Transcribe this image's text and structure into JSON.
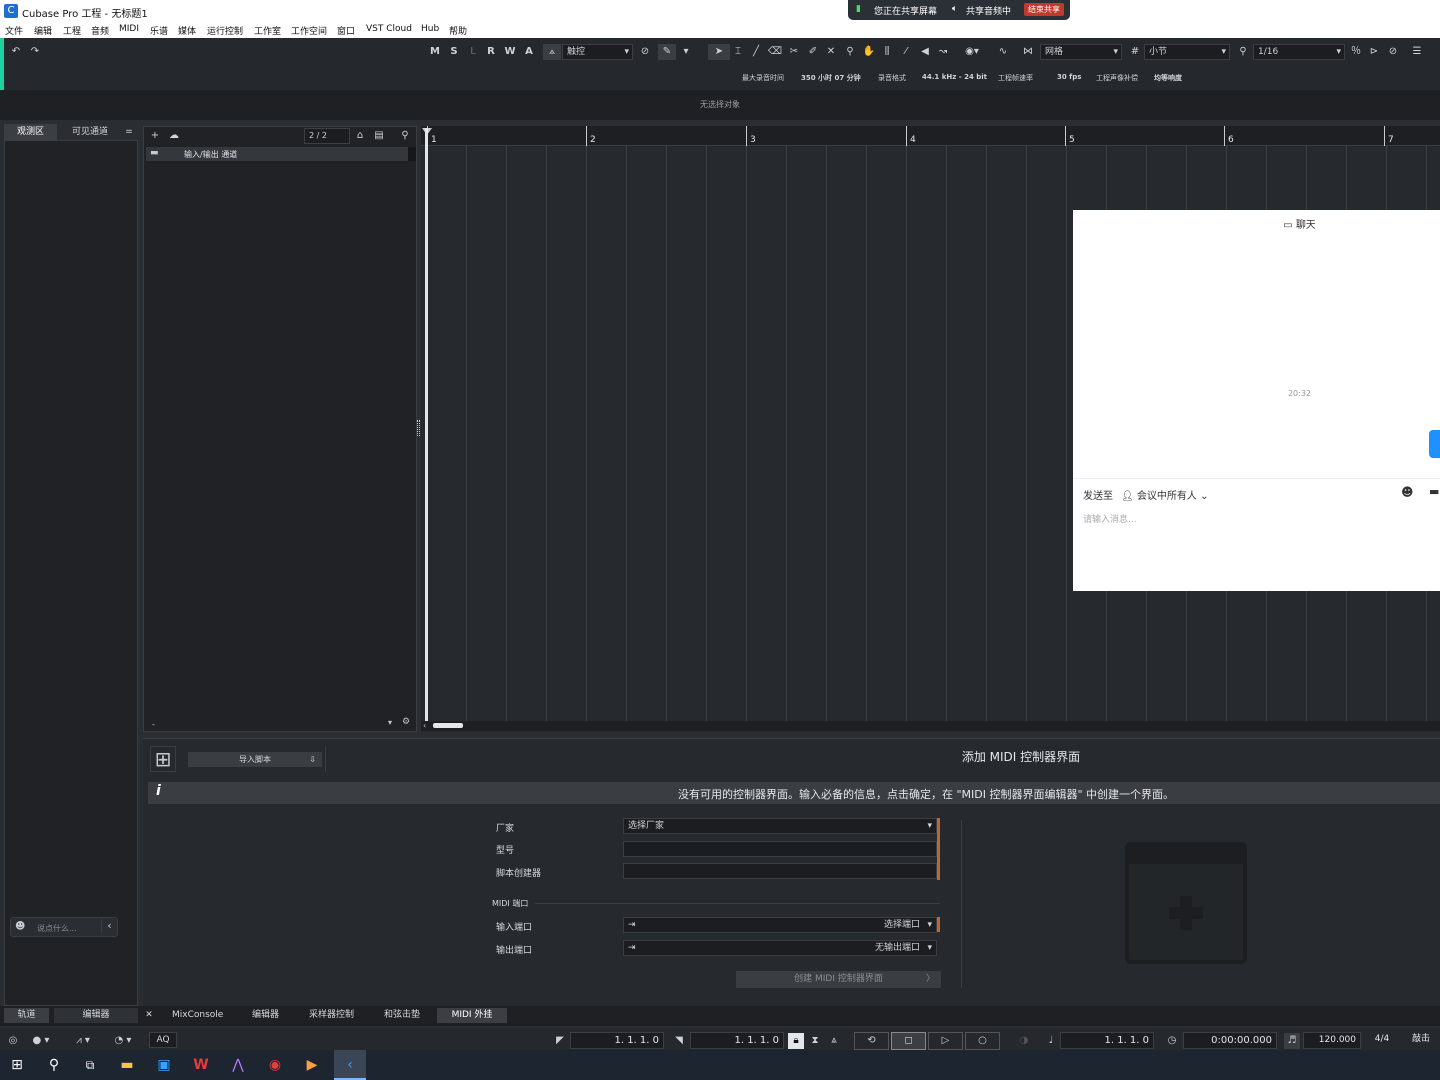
{
  "window": {
    "title": "Cubase Pro 工程 - 无标题1",
    "logo": "C"
  },
  "share": {
    "sharing": "您正在共享屏幕",
    "audio": "共享音频中",
    "end": "结束共享"
  },
  "menu": [
    "文件",
    "编辑",
    "工程",
    "音频",
    "MIDI",
    "乐谱",
    "媒体",
    "运行控制",
    "工作室",
    "工作空间",
    "窗口",
    "VST Cloud",
    "Hub",
    "帮助"
  ],
  "toolbar": {
    "track_buttons": [
      "M",
      "S",
      "L",
      "R",
      "W",
      "A"
    ],
    "automation_mode": "触控",
    "snap_type": "网格",
    "grid": "小节",
    "quantize": "1/16",
    "info": {
      "max_rec_label": "最大录音时间",
      "max_rec_value": "350 小时 07 分钟",
      "rec_format_label": "录音格式",
      "rec_format_value": "44.1 kHz - 24 bit",
      "framerate_label": "工程帧速率",
      "framerate_value": "30 fps",
      "pan_label": "工程声像补偿",
      "pan_value": "均等响度"
    },
    "no_selection": "无选择对象"
  },
  "left_panel": {
    "tab_inspector": "观测区",
    "tab_visible": "可见通道",
    "menu_icon": "=",
    "chat_placeholder": "说点什么..."
  },
  "track_list": {
    "counter": "2 / 2",
    "track_name": "输入/输出 通道",
    "footer": "-"
  },
  "ruler": [
    "1",
    "2",
    "3",
    "4",
    "5",
    "6",
    "7"
  ],
  "chat": {
    "title": "聊天",
    "time": "20:32",
    "send_to_label": "发送至",
    "send_to_value": "会议中所有人",
    "input_placeholder": "请输入消息..."
  },
  "bottom": {
    "import_script": "导入脚本",
    "header": "添加 MIDI 控制器界面",
    "info": "没有可用的控制器界面。输入必备的信息，点击确定，在 \"MIDI 控制器界面编辑器\" 中创建一个界面。",
    "vendor_label": "厂家",
    "vendor_value": "选择厂家",
    "model_label": "型号",
    "script_creator_label": "脚本创建器",
    "midi_ports_label": "MIDI 端口",
    "input_label": "输入端口",
    "input_value": "选择端口",
    "output_label": "输出端口",
    "output_value": "无输出端口",
    "create_button": "创建 MIDI 控制器界面"
  },
  "zone_tabs": {
    "tracks": "轨道",
    "editor": "编辑器",
    "close": "✕",
    "mixconsole": "MixConsole",
    "editor2": "编辑器",
    "sampler": "采样器控制",
    "chord": "和弦击垫",
    "midi": "MIDI 外挂"
  },
  "transport": {
    "aq": "AQ",
    "left_locator": "1. 1. 1.   0",
    "right_locator": "1. 1. 1.   0",
    "position_bars": "1. 1. 1.   0",
    "position_time": "0:00:00.000",
    "tempo": "120.000",
    "signature": "4/4",
    "tap": "敲击"
  }
}
